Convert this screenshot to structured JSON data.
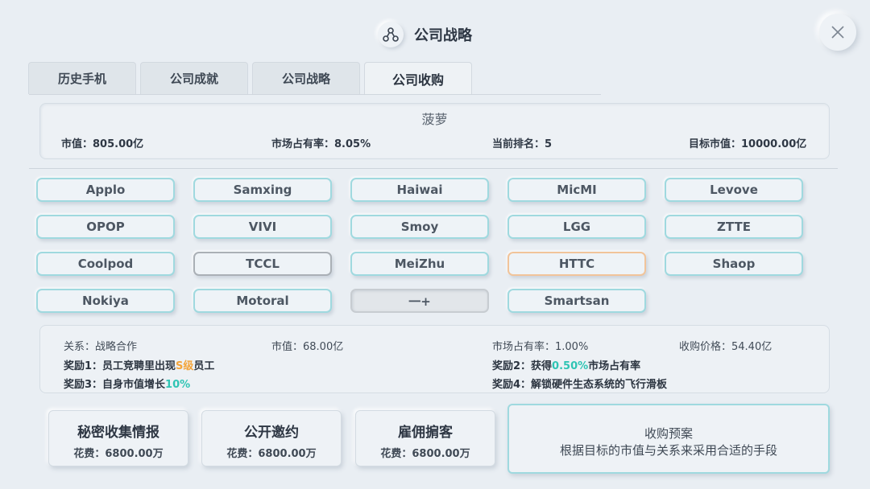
{
  "header": {
    "title": "公司战略",
    "icon": "strategy-nodes-icon",
    "close_icon": "close-icon"
  },
  "tabs": [
    {
      "label": "历史手机",
      "active": false
    },
    {
      "label": "公司成就",
      "active": false
    },
    {
      "label": "公司战略",
      "active": false
    },
    {
      "label": "公司收购",
      "active": true
    }
  ],
  "company": {
    "name": "菠萝",
    "market_value": "市值：805.00亿",
    "market_share": "市场占有率：8.05%",
    "rank": "当前排名：5",
    "target_value": "目标市值：10000.00亿"
  },
  "companies": [
    {
      "label": "Applo",
      "border": "teal"
    },
    {
      "label": "Samxing",
      "border": "teal"
    },
    {
      "label": "Haiwai",
      "border": "teal"
    },
    {
      "label": "MicMI",
      "border": "teal"
    },
    {
      "label": "Levove",
      "border": "teal"
    },
    {
      "label": "OPOP",
      "border": "teal"
    },
    {
      "label": "VIVI",
      "border": "teal"
    },
    {
      "label": "Smoy",
      "border": "teal"
    },
    {
      "label": "LGG",
      "border": "teal"
    },
    {
      "label": "ZTTE",
      "border": "teal"
    },
    {
      "label": "Coolpod",
      "border": "teal"
    },
    {
      "label": "TCCL",
      "border": "gray"
    },
    {
      "label": "MeiZhu",
      "border": "teal"
    },
    {
      "label": "HTTC",
      "border": "orange"
    },
    {
      "label": "Shaop",
      "border": "teal"
    },
    {
      "label": "Nokiya",
      "border": "teal"
    },
    {
      "label": "Motoral",
      "border": "teal"
    },
    {
      "label": "一+",
      "border": "selected"
    },
    {
      "label": "Smartsan",
      "border": "teal"
    }
  ],
  "detail": {
    "relation": "关系：战略合作",
    "market_value": "市值：68.00亿",
    "market_share": "市场占有率：1.00%",
    "price": "收购价格：54.40亿",
    "reward1_pre": "奖励1：员工竞聘里出现",
    "reward1_hl": "S级",
    "reward1_post": "员工",
    "reward2_pre": "奖励2：获得",
    "reward2_hl": "0.50%",
    "reward2_post": "市场占有率",
    "reward3_pre": "奖励3：自身市值增长",
    "reward3_hl": "10%",
    "reward4": "奖励4：解锁硬件生态系统的飞行滑板"
  },
  "actions": [
    {
      "title": "秘密收集情报",
      "cost": "花费：6800.00万"
    },
    {
      "title": "公开邀约",
      "cost": "花费：6800.00万"
    },
    {
      "title": "雇佣掮客",
      "cost": "花费：6800.00万"
    }
  ],
  "plan": {
    "title": "收购预案",
    "subtitle": "根据目标的市值与关系来采用合适的手段"
  },
  "colors": {
    "background": "#e9eef3",
    "teal_border": "#9fd9df",
    "highlight_orange": "#f3a43a",
    "highlight_teal": "#2fc4b4"
  }
}
